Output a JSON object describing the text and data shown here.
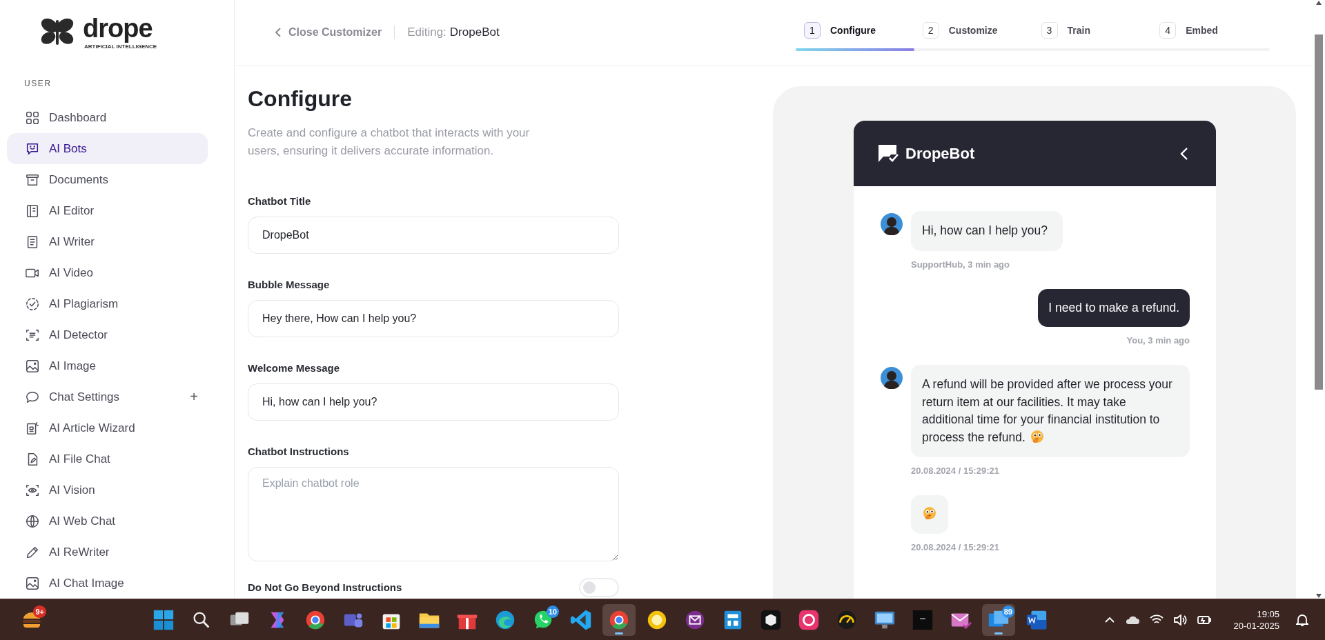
{
  "sidebar": {
    "logo": {
      "name": "drope",
      "tagline": "ARTIFICIAL INTELLIGENCE"
    },
    "section": "USER",
    "items": [
      {
        "label": "Dashboard",
        "selected": false
      },
      {
        "label": "AI Bots",
        "selected": true
      },
      {
        "label": "Documents",
        "selected": false
      },
      {
        "label": "AI Editor",
        "selected": false
      },
      {
        "label": "AI Writer",
        "selected": false
      },
      {
        "label": "AI Video",
        "selected": false
      },
      {
        "label": "AI Plagiarism",
        "selected": false
      },
      {
        "label": "AI Detector",
        "selected": false
      },
      {
        "label": "AI Image",
        "selected": false
      },
      {
        "label": "Chat Settings",
        "selected": false,
        "action": "+"
      },
      {
        "label": "AI Article Wizard",
        "selected": false
      },
      {
        "label": "AI File Chat",
        "selected": false
      },
      {
        "label": "AI Vision",
        "selected": false
      },
      {
        "label": "AI Web Chat",
        "selected": false
      },
      {
        "label": "AI ReWriter",
        "selected": false
      },
      {
        "label": "AI Chat Image",
        "selected": false
      }
    ]
  },
  "header": {
    "back": "Close Customizer",
    "editing_label": "Editing:",
    "editing_name": "DropeBot",
    "steps": [
      {
        "number": "1",
        "label": "Configure",
        "selected": true
      },
      {
        "number": "2",
        "label": "Customize",
        "selected": false
      },
      {
        "number": "3",
        "label": "Train",
        "selected": false
      },
      {
        "number": "4",
        "label": "Embed",
        "selected": false
      }
    ],
    "progress": {
      "level": 0.25
    }
  },
  "form": {
    "title": "Configure",
    "description": "Create and configure a chatbot that interacts with your users, ensuring it delivers accurate information.",
    "fields": [
      {
        "kind": "input",
        "label": "Chatbot Title",
        "value": "DropeBot"
      },
      {
        "kind": "input",
        "label": "Bubble Message",
        "value": "Hey there, How can I help you?"
      },
      {
        "kind": "input",
        "label": "Welcome Message",
        "value": "Hi, how can I help you?"
      },
      {
        "kind": "textarea",
        "label": "Chatbot Instructions",
        "placeholder": "Explain chatbot role"
      },
      {
        "kind": "toggle",
        "label": "Do Not Go Beyond Instructions",
        "on": false
      }
    ]
  },
  "preview": {
    "title": "DropeBot",
    "messages": [
      {
        "kind": "bot",
        "avatar": true,
        "text": "Hi, how can I help you?",
        "meta": "SupportHub, 3 min ago"
      },
      {
        "kind": "user",
        "text": "I need to make a refund.",
        "meta": "You, 3 min ago"
      },
      {
        "kind": "bot",
        "avatar": true,
        "text": "A refund will be provided after we process your return item at our facilities. It may take additional time for your financial institution to process the refund.",
        "emoji": true,
        "meta": "20.08.2024 / 15:29:21"
      },
      {
        "kind": "bot",
        "avatar": false,
        "emoji": true,
        "meta": "20.08.2024 / 15:29:21"
      }
    ]
  },
  "taskbar": {
    "widget": {
      "badge": "9+"
    },
    "apps": [
      {
        "selected": false
      },
      {
        "selected": false
      },
      {
        "selected": false
      },
      {
        "selected": false
      },
      {
        "selected": false
      },
      {
        "selected": false
      },
      {
        "selected": false
      },
      {
        "selected": false
      },
      {
        "selected": false
      },
      {
        "selected": false
      },
      {
        "selected": false,
        "badge": "10"
      },
      {
        "selected": false
      },
      {
        "selected": true
      },
      {
        "selected": false
      },
      {
        "selected": false
      },
      {
        "selected": false
      },
      {
        "selected": false
      },
      {
        "selected": false
      },
      {
        "selected": false
      },
      {
        "selected": false
      },
      {
        "selected": false
      },
      {
        "selected": false
      },
      {
        "selected": true,
        "badge": "89"
      },
      {
        "selected": false
      }
    ],
    "clock": {
      "time": "19:05",
      "date": "20-01-2025"
    }
  }
}
